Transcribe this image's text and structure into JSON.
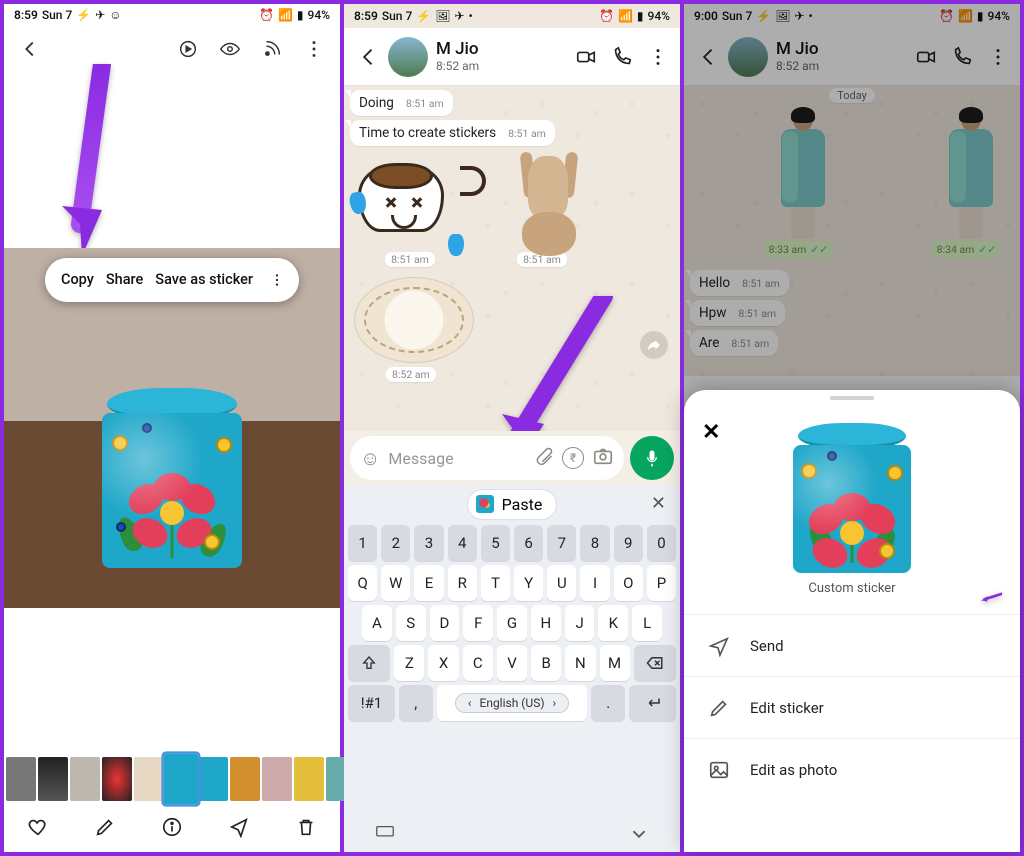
{
  "status": {
    "t1": "8:59",
    "t2": "8:59",
    "t3": "9:00",
    "day": "Sun 7",
    "battery": "94%"
  },
  "panel1": {
    "context": {
      "copy": "Copy",
      "share": "Share",
      "save_sticker": "Save as sticker"
    }
  },
  "panel2": {
    "contact": {
      "name": "M Jio",
      "last_seen": "8:52 am"
    },
    "msgs": {
      "doing": "Doing",
      "doing_time": "8:51 am",
      "line2": "Time to create stickers",
      "line2_time": "8:51 am",
      "st_time": "8:51 am",
      "saucer_time": "8:52 am"
    },
    "input": {
      "placeholder": "Message"
    },
    "clip": {
      "paste": "Paste"
    },
    "keys": {
      "nums": [
        "1",
        "2",
        "3",
        "4",
        "5",
        "6",
        "7",
        "8",
        "9",
        "0"
      ],
      "r1": [
        "Q",
        "W",
        "E",
        "R",
        "T",
        "Y",
        "U",
        "I",
        "O",
        "P"
      ],
      "r2": [
        "A",
        "S",
        "D",
        "F",
        "G",
        "H",
        "J",
        "K",
        "L"
      ],
      "r3": [
        "Z",
        "X",
        "C",
        "V",
        "B",
        "N",
        "M"
      ],
      "sym": "!#1",
      "comma": ",",
      "lang": "English (US)",
      "period": "."
    }
  },
  "panel3": {
    "contact": {
      "name": "M Jio",
      "last_seen": "8:52 am"
    },
    "today": "Today",
    "out1_time": "8:33 am",
    "out2_time": "8:34 am",
    "in": {
      "hello": "Hello",
      "hpw": "Hpw",
      "are": "Are",
      "t": "8:51 am"
    },
    "sheet": {
      "caption": "Custom sticker",
      "send": "Send",
      "edit_sticker": "Edit sticker",
      "edit_photo": "Edit as photo"
    }
  }
}
